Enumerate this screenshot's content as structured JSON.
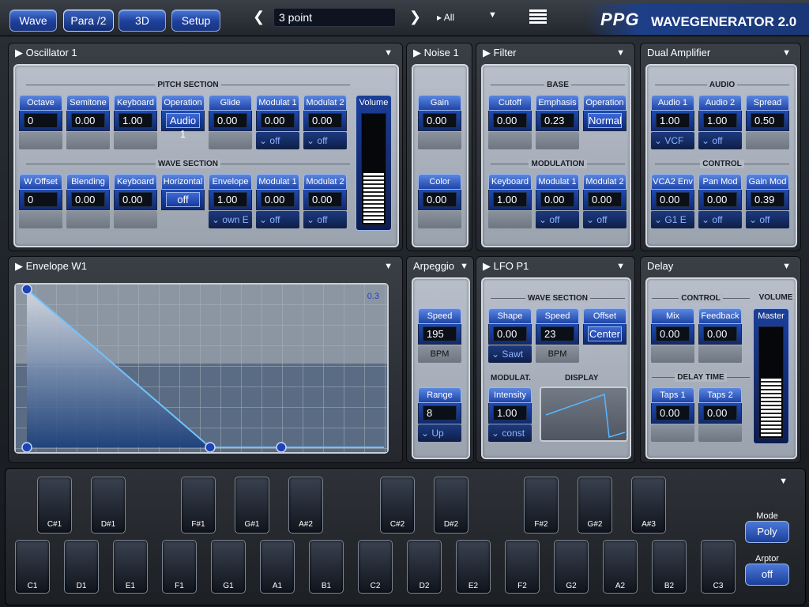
{
  "topbar": {
    "tabs": [
      "Wave",
      "Para /2",
      "3D",
      "Setup"
    ],
    "preset_name": "3 point",
    "filter_label": "▸ All",
    "logo_mark": "PPG",
    "logo_text": "WAVEGENERATOR 2.0"
  },
  "oscillator": {
    "title": "Oscillator 1",
    "pitch_section": "PITCH SECTION",
    "wave_section": "WAVE SECTION",
    "pitch": [
      {
        "label": "Octave",
        "value": "0"
      },
      {
        "label": "Semitone",
        "value": "0.00"
      },
      {
        "label": "Keyboard",
        "value": "1.00"
      },
      {
        "label": "Operation",
        "value": "Audio 1"
      },
      {
        "label": "Glide",
        "value": "0.00"
      },
      {
        "label": "Modulat 1",
        "value": "0.00",
        "sub": "⌄ off"
      },
      {
        "label": "Modulat 2",
        "value": "0.00",
        "sub": "⌄ off"
      }
    ],
    "wave": [
      {
        "label": "W Offset",
        "value": "0"
      },
      {
        "label": "Blending",
        "value": "0.00"
      },
      {
        "label": "Keyboard",
        "value": "0.00"
      },
      {
        "label": "Horizontal",
        "value": "off"
      },
      {
        "label": "Envelope",
        "value": "1.00",
        "sub": "⌄ own E"
      },
      {
        "label": "Modulat 1",
        "value": "0.00",
        "sub": "⌄ off"
      },
      {
        "label": "Modulat 2",
        "value": "0.00",
        "sub": "⌄ off"
      }
    ],
    "volume_label": "Volume",
    "volume_level": 0.45
  },
  "noise": {
    "title": "Noise 1",
    "gain": {
      "label": "Gain",
      "value": "0.00"
    },
    "color": {
      "label": "Color",
      "value": "0.00"
    }
  },
  "filter": {
    "title": "Filter",
    "base_section": "BASE",
    "mod_section": "MODULATION",
    "base": [
      {
        "label": "Cutoff",
        "value": "0.00"
      },
      {
        "label": "Emphasis",
        "value": "0.23"
      },
      {
        "label": "Operation",
        "value": "Normal"
      }
    ],
    "mod": [
      {
        "label": "Keyboard",
        "value": "1.00"
      },
      {
        "label": "Modulat 1",
        "value": "0.00",
        "sub": "⌄ off"
      },
      {
        "label": "Modulat 2",
        "value": "0.00",
        "sub": "⌄ off"
      }
    ]
  },
  "amp": {
    "title": "Dual Amplifier",
    "audio_section": "AUDIO",
    "control_section": "CONTROL",
    "audio": [
      {
        "label": "Audio 1",
        "value": "1.00",
        "sub": "⌄ VCF"
      },
      {
        "label": "Audio 2",
        "value": "1.00",
        "sub": "⌄ off"
      },
      {
        "label": "Spread",
        "value": "0.50"
      }
    ],
    "control": [
      {
        "label": "VCA2 Env",
        "value": "0.00",
        "sub": "⌄ G1 E"
      },
      {
        "label": "Pan Mod",
        "value": "0.00",
        "sub": "⌄ off"
      },
      {
        "label": "Gain Mod",
        "value": "0.39",
        "sub": "⌄ off"
      }
    ]
  },
  "envelope": {
    "title": "Envelope W1",
    "corner_value": "0.3"
  },
  "arpeggio": {
    "title": "Arpeggio",
    "speed": {
      "label": "Speed",
      "value": "195",
      "sub": "BPM"
    },
    "range": {
      "label": "Range",
      "value": "8",
      "sub": "⌄ Up"
    }
  },
  "lfo": {
    "title": "LFO P1",
    "wave_section": "WAVE SECTION",
    "modulat_label": "MODULAT.",
    "display_label": "DISPLAY",
    "shape": {
      "label": "Shape",
      "value": "0.00",
      "sub": "⌄ Sawt"
    },
    "speed": {
      "label": "Speed",
      "value": "23",
      "sub": "BPM"
    },
    "offset": {
      "label": "Offset",
      "value": "Center"
    },
    "intensity": {
      "label": "Intensity",
      "value": "1.00",
      "sub": "⌄ const"
    }
  },
  "delay": {
    "title": "Delay",
    "control_section": "CONTROL",
    "time_section": "DELAY TIME",
    "volume_section": "VOLUME",
    "mix": {
      "label": "Mix",
      "value": "0.00"
    },
    "feedback": {
      "label": "Feedback",
      "value": "0.00"
    },
    "taps1": {
      "label": "Taps 1",
      "value": "0.00"
    },
    "taps2": {
      "label": "Taps 2",
      "value": "0.00"
    },
    "master_label": "Master",
    "master_level": 0.52
  },
  "keyboard": {
    "white_keys": [
      "C1",
      "D1",
      "E1",
      "F1",
      "G1",
      "A1",
      "B1",
      "C2",
      "D2",
      "E2",
      "F2",
      "G2",
      "A2",
      "B2",
      "C3"
    ],
    "black_keys": [
      "C#1",
      "D#1",
      "F#1",
      "G#1",
      "A#2",
      "C#2",
      "D#2",
      "F#2",
      "G#2",
      "A#3"
    ],
    "mode_label": "Mode",
    "mode_value": "Poly",
    "arptor_label": "Arptor",
    "arptor_value": "off"
  },
  "colors": {
    "accent": "#1f45a8",
    "panel": "#a8b0bc",
    "highlight": "#5a86e0"
  }
}
